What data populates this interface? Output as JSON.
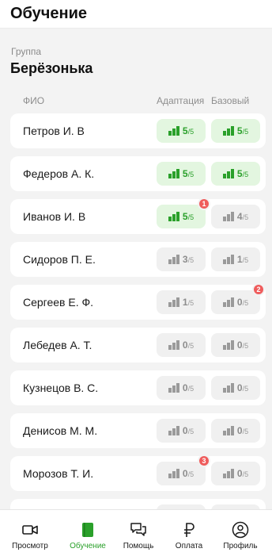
{
  "header": {
    "title": "Обучение"
  },
  "group": {
    "label": "Группа",
    "name": "Берёзонька"
  },
  "columns": {
    "fio": "ФИО",
    "adaptation": "Адаптация",
    "basic": "Базовый"
  },
  "total_label": "/5",
  "rows": [
    {
      "name": "Петров И. В",
      "adaptation": {
        "value": "5",
        "done": true,
        "alert": ""
      },
      "basic": {
        "value": "5",
        "done": true,
        "alert": ""
      }
    },
    {
      "name": "Федеров А. К.",
      "adaptation": {
        "value": "5",
        "done": true,
        "alert": ""
      },
      "basic": {
        "value": "5",
        "done": true,
        "alert": ""
      }
    },
    {
      "name": "Иванов И. В",
      "adaptation": {
        "value": "5",
        "done": true,
        "alert": "1"
      },
      "basic": {
        "value": "4",
        "done": false,
        "alert": ""
      }
    },
    {
      "name": "Сидоров П. Е.",
      "adaptation": {
        "value": "3",
        "done": false,
        "alert": ""
      },
      "basic": {
        "value": "1",
        "done": false,
        "alert": ""
      }
    },
    {
      "name": "Сергеев Е. Ф.",
      "adaptation": {
        "value": "1",
        "done": false,
        "alert": ""
      },
      "basic": {
        "value": "0",
        "done": false,
        "alert": "2"
      }
    },
    {
      "name": "Лебедев А. Т.",
      "adaptation": {
        "value": "0",
        "done": false,
        "alert": ""
      },
      "basic": {
        "value": "0",
        "done": false,
        "alert": ""
      }
    },
    {
      "name": "Кузнецов В. С.",
      "adaptation": {
        "value": "0",
        "done": false,
        "alert": ""
      },
      "basic": {
        "value": "0",
        "done": false,
        "alert": ""
      }
    },
    {
      "name": "Денисов М. М.",
      "adaptation": {
        "value": "0",
        "done": false,
        "alert": ""
      },
      "basic": {
        "value": "0",
        "done": false,
        "alert": ""
      }
    },
    {
      "name": "Морозов Т. И.",
      "adaptation": {
        "value": "0",
        "done": false,
        "alert": "3"
      },
      "basic": {
        "value": "0",
        "done": false,
        "alert": ""
      }
    },
    {
      "name": "",
      "adaptation": {
        "value": "",
        "done": false,
        "alert": ""
      },
      "basic": {
        "value": "",
        "done": false,
        "alert": ""
      }
    }
  ],
  "nav": [
    {
      "label": "Просмотр",
      "icon": "video-camera-icon",
      "active": false
    },
    {
      "label": "Обучение",
      "icon": "book-icon",
      "active": true
    },
    {
      "label": "Помощь",
      "icon": "chat-bubbles-icon",
      "active": false
    },
    {
      "label": "Оплата",
      "icon": "ruble-icon",
      "active": false
    },
    {
      "label": "Профиль",
      "icon": "profile-icon",
      "active": false
    }
  ],
  "colors": {
    "accent": "#2aa02a",
    "alert": "#ef5c5c",
    "done_bg": "#e3f6e0",
    "idle_bg": "#f0f0f0"
  }
}
